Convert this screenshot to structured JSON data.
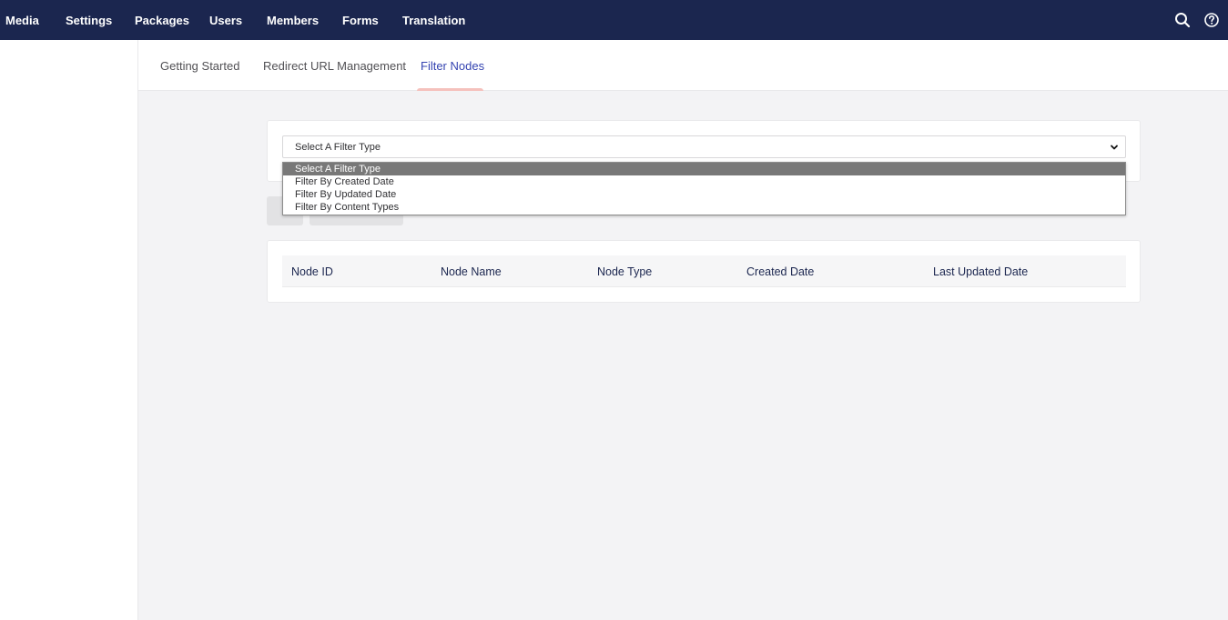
{
  "topnav": {
    "items": [
      {
        "label": "Media",
        "name": "nav-media"
      },
      {
        "label": "Settings",
        "name": "nav-settings"
      },
      {
        "label": "Packages",
        "name": "nav-packages"
      },
      {
        "label": "Users",
        "name": "nav-users"
      },
      {
        "label": "Members",
        "name": "nav-members"
      },
      {
        "label": "Forms",
        "name": "nav-forms"
      },
      {
        "label": "Translation",
        "name": "nav-translation"
      }
    ],
    "search_icon": "search-icon",
    "help_icon": "help-icon"
  },
  "subtabs": {
    "items": [
      {
        "label": "Getting Started"
      },
      {
        "label": "Redirect URL Management"
      },
      {
        "label": "Filter Nodes"
      }
    ],
    "active_index": 2
  },
  "filter": {
    "selected": "Select A Filter Type",
    "options": [
      "Select A Filter Type",
      "Filter By Created Date",
      "Filter By Updated Date",
      "Filter By Content Types"
    ]
  },
  "table": {
    "columns": [
      "Node ID",
      "Node Name",
      "Node Type",
      "Created Date",
      "Last Updated Date"
    ]
  },
  "colors": {
    "topbar": "#1b264f",
    "active_tab": "#3544b1",
    "tab_underline": "#f5c1bc",
    "background": "#f3f3f5"
  }
}
